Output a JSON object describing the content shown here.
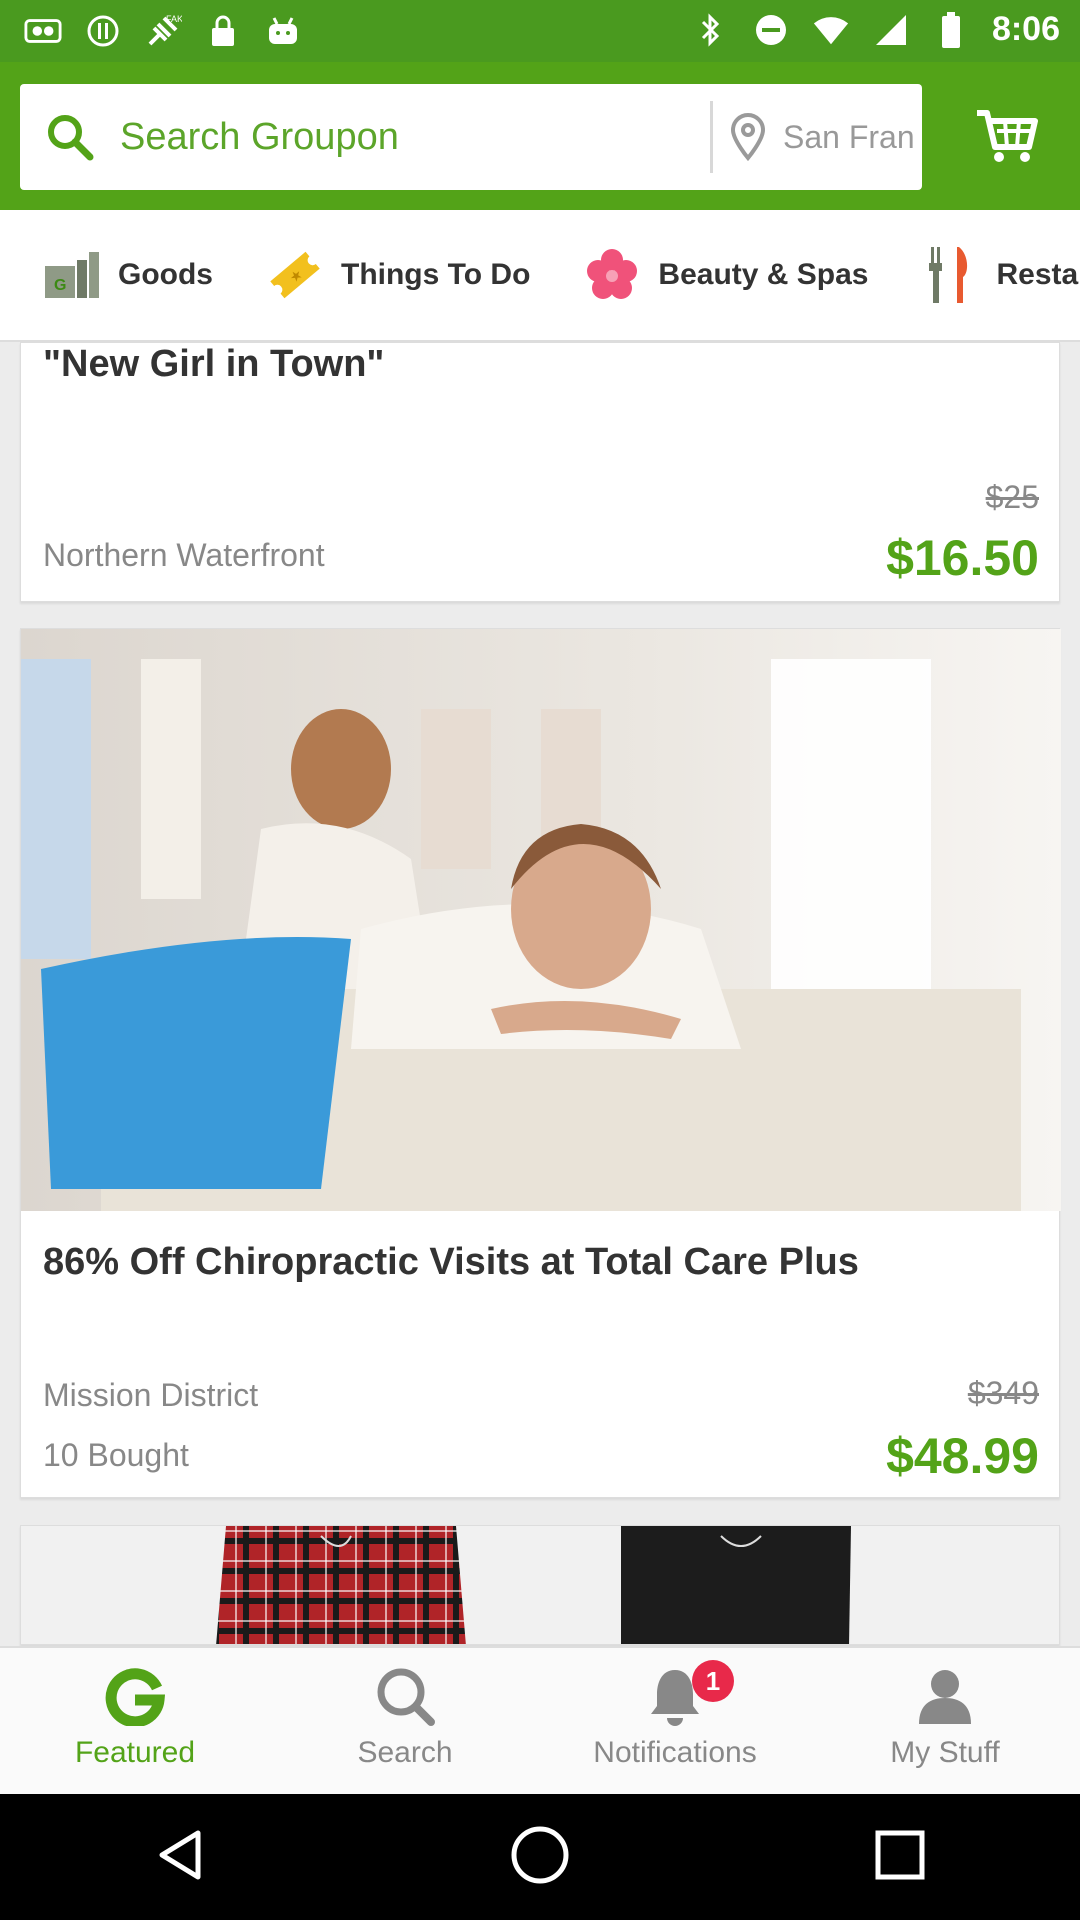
{
  "status_bar": {
    "time": "8:06",
    "left_icons": [
      "notification-icon",
      "warning-icon",
      "fake-gps-icon",
      "lock-icon",
      "android-icon"
    ],
    "right_icons": [
      "bluetooth-icon",
      "dnd-icon",
      "wifi-icon",
      "signal-icon",
      "battery-icon"
    ]
  },
  "header": {
    "search_placeholder": "Search Groupon",
    "location_placeholder": "San Francisco",
    "cart_icon": "cart-icon"
  },
  "tabs": [
    {
      "label": "Goods",
      "icon": "goods-icon"
    },
    {
      "label": "Things To Do",
      "icon": "ticket-icon"
    },
    {
      "label": "Beauty & Spas",
      "icon": "flower-icon"
    },
    {
      "label": "Restaurants",
      "icon": "utensils-icon"
    }
  ],
  "deals": [
    {
      "title": "\"New Girl in Town\"",
      "location": "Northern Waterfront",
      "original_price": "$25",
      "price": "$16.50"
    },
    {
      "title": "86% Off Chiropractic Visits at Total Care Plus",
      "location": "Mission District",
      "bought": "10 Bought",
      "original_price": "$349",
      "price": "$48.99"
    }
  ],
  "bottom_nav": [
    {
      "label": "Featured",
      "icon": "groupon-g-icon",
      "active": true
    },
    {
      "label": "Search",
      "icon": "search-icon",
      "active": false
    },
    {
      "label": "Notifications",
      "icon": "bell-icon",
      "active": false,
      "badge": "1"
    },
    {
      "label": "My Stuff",
      "icon": "person-icon",
      "active": false
    }
  ],
  "colors": {
    "brand_green": "#53a318",
    "status_green": "#4a9a1f",
    "badge_red": "#e8294a"
  }
}
